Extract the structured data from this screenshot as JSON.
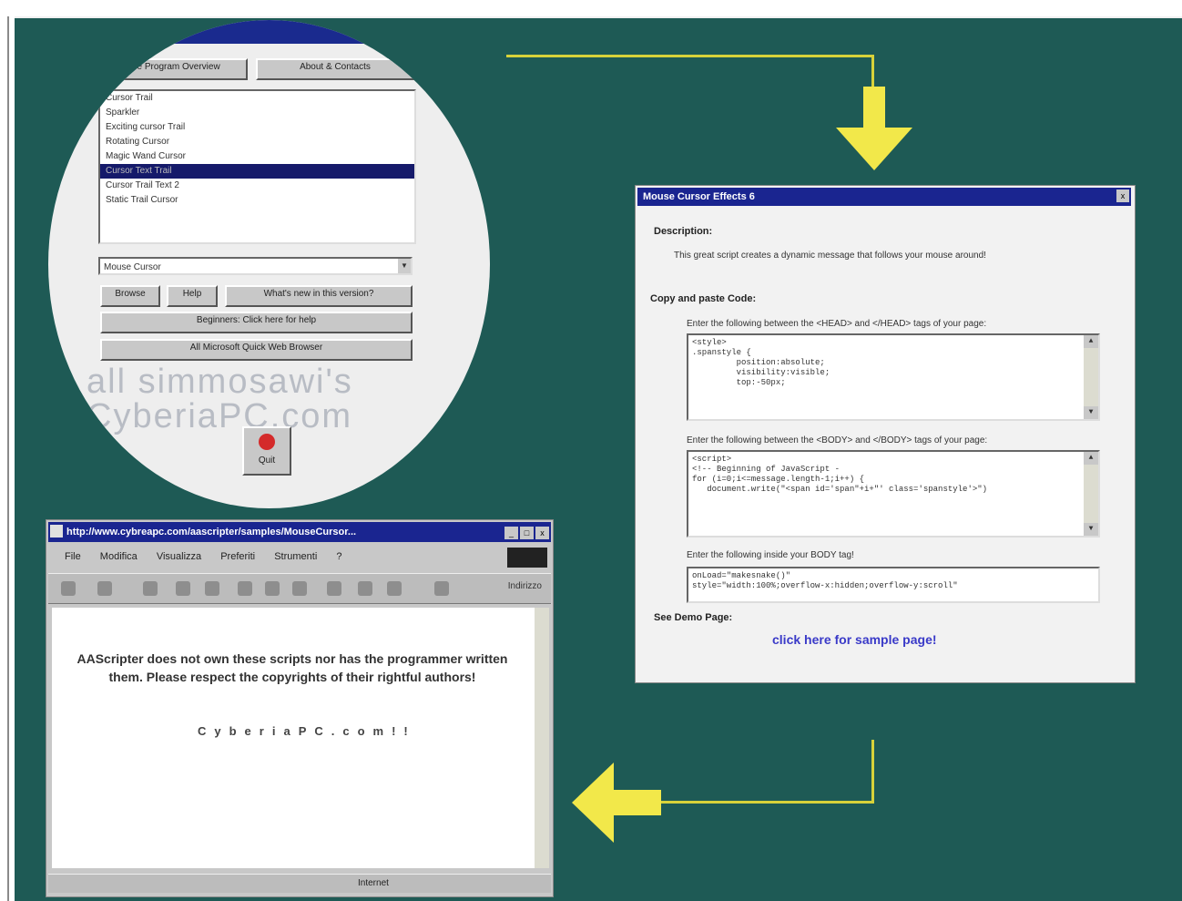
{
  "colors": {
    "background": "#1e5a55",
    "arrow": "#f2e84a",
    "connector_line": "#d8d23a",
    "titlebar": "#1a2590",
    "link": "#3a3ac8"
  },
  "menu": {
    "top_buttons": [
      "See Program Overview",
      "About & Contacts"
    ],
    "list_items": [
      "Cursor Trail",
      "Sparkler",
      "Exciting cursor Trail",
      "Rotating Cursor",
      "Magic Wand Cursor",
      "Cursor Text Trail",
      "Cursor Trail Text 2",
      "Static Trail Cursor"
    ],
    "selected_index": 5,
    "combo_value": "Mouse Cursor",
    "row_buttons": [
      "Browse",
      "Help",
      "What's new in this version?"
    ],
    "wide_buttons": [
      "Beginners: Click here for help",
      "All Microsoft Quick Web Browser"
    ],
    "watermark_lines": [
      "all simmosawi's",
      "CyberiaPC.com"
    ],
    "quit_label": "Quit",
    "quit_icon": "stop-icon"
  },
  "dialog": {
    "title": "Mouse Cursor Effects 6",
    "close_glyph": "x",
    "description_label": "Description:",
    "description_text": "This great script creates a dynamic message that follows your mouse around!",
    "copy_label": "Copy and paste Code:",
    "head_instruction": "Enter the following between the <HEAD> and </HEAD> tags of your page:",
    "head_code": [
      "<style>",
      ".spanstyle {",
      "         position:absolute;",
      "         visibility:visible;",
      "         top:-50px;"
    ],
    "body_instruction": "Enter the following between the <BODY> and </BODY> tags of your page:",
    "body_code": [
      "<script>",
      "<!-- Beginning of JavaScript -",
      "",
      "for (i=0;i<=message.length-1;i++) {",
      "   document.write(\"<span id='span\"+i+\"' class='spanstyle'>\")"
    ],
    "tag_instruction": "Enter the following inside your BODY tag!",
    "tag_code": [
      "onLoad=\"makesnake()\"",
      "style=\"width:100%;overflow-x:hidden;overflow-y:scroll\""
    ],
    "demo_label": "See Demo Page:",
    "demo_link": "click here for sample page!"
  },
  "browser": {
    "title": "http://www.cybreapc.com/aascripter/samples/MouseCursor...",
    "win_buttons": [
      "_",
      "□",
      "x"
    ],
    "menus": [
      "File",
      "Modifica",
      "Visualizza",
      "Preferiti",
      "Strumenti",
      "?"
    ],
    "toolbar_label": "Indirizzo",
    "message": "AAScripter does not own these scripts nor has the programmer written them. Please respect the copyrights of their rightful authors!",
    "signature": "CyberiaPC.com!!",
    "status_zone": "Internet"
  }
}
